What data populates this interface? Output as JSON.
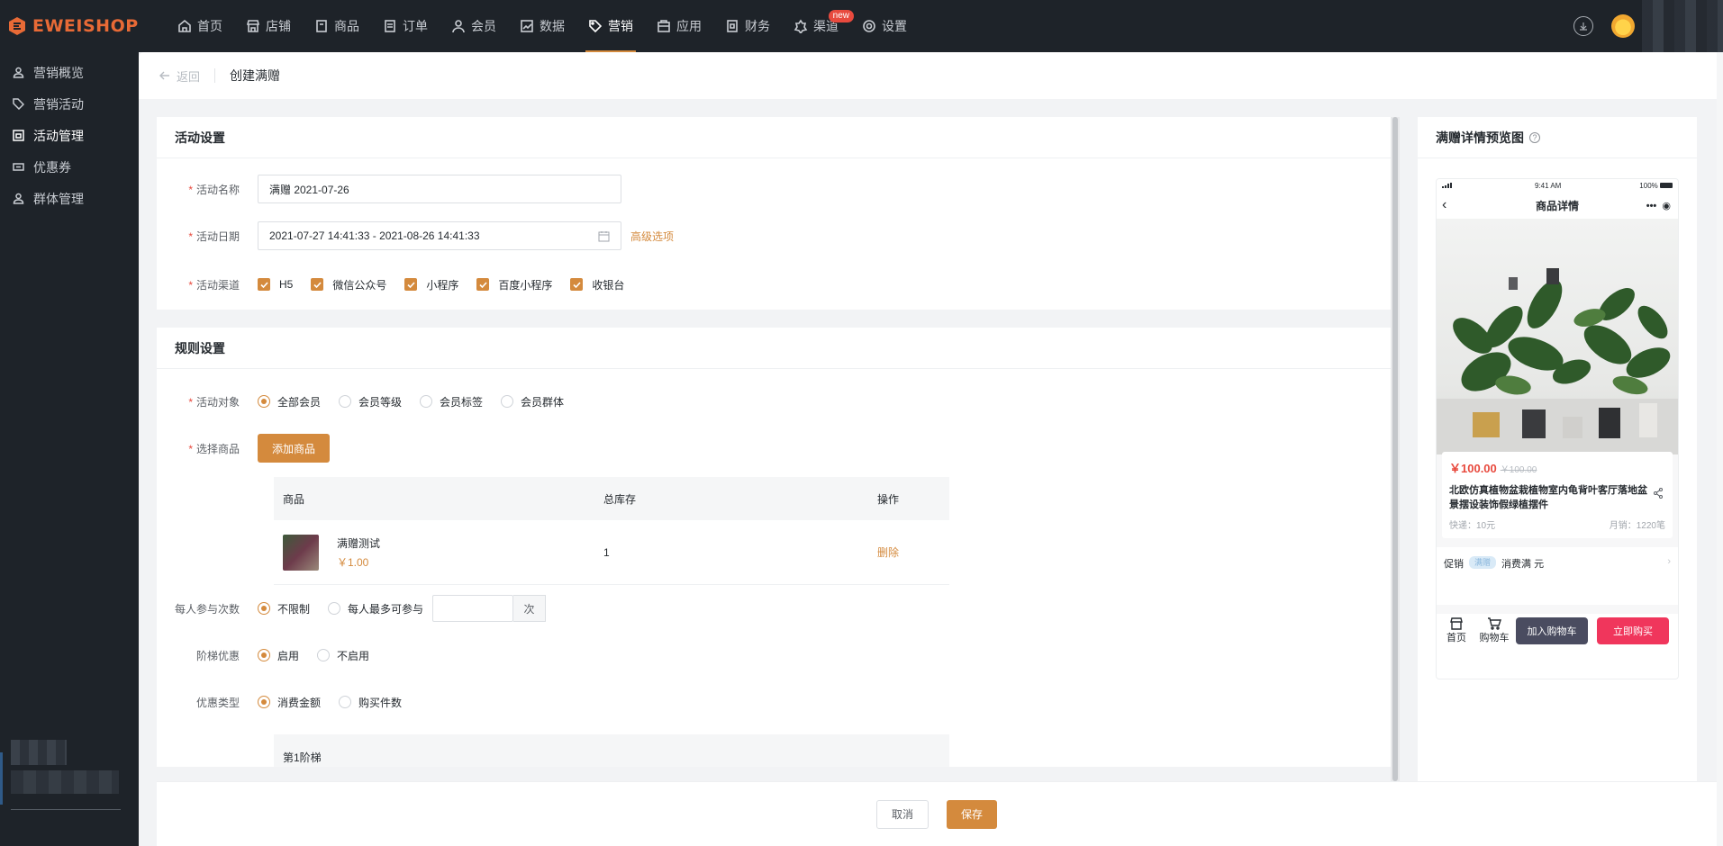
{
  "app": {
    "logo_text": "EWEISHOP"
  },
  "nav": {
    "items": [
      {
        "label": "首页",
        "icon": "home-icon"
      },
      {
        "label": "店铺",
        "icon": "store-icon"
      },
      {
        "label": "商品",
        "icon": "goods-icon"
      },
      {
        "label": "订单",
        "icon": "order-icon"
      },
      {
        "label": "会员",
        "icon": "user-icon"
      },
      {
        "label": "数据",
        "icon": "chart-icon"
      },
      {
        "label": "营销",
        "icon": "tag-icon",
        "active": true
      },
      {
        "label": "应用",
        "icon": "app-icon"
      },
      {
        "label": "财务",
        "icon": "finance-icon"
      },
      {
        "label": "渠道",
        "icon": "channel-icon",
        "badge": "new"
      },
      {
        "label": "设置",
        "icon": "gear-icon"
      }
    ]
  },
  "sidebar": {
    "items": [
      {
        "label": "营销概览"
      },
      {
        "label": "营销活动"
      },
      {
        "label": "活动管理",
        "active": true
      },
      {
        "label": "优惠券"
      },
      {
        "label": "群体管理"
      }
    ]
  },
  "breadcrumb": {
    "back": "返回",
    "title": "创建满赠"
  },
  "activity_settings": {
    "title": "活动设置",
    "name_label": "活动名称",
    "name_value": "满赠  2021-07-26",
    "date_label": "活动日期",
    "date_value": "2021-07-27 14:41:33  -  2021-08-26 14:41:33",
    "advanced_link": "高级选项",
    "channel_label": "活动渠道",
    "channels": [
      "H5",
      "微信公众号",
      "小程序",
      "百度小程序",
      "收银台"
    ]
  },
  "rule_settings": {
    "title": "规则设置",
    "target_label": "活动对象",
    "targets": [
      "全部会员",
      "会员等级",
      "会员标签",
      "会员群体"
    ],
    "goods_label": "选择商品",
    "add_goods_button": "添加商品",
    "table": {
      "headers": [
        "商品",
        "总库存",
        "操作"
      ],
      "rows": [
        {
          "name": "满赠测试",
          "price": "￥1.00",
          "stock": "1",
          "action": "删除"
        }
      ]
    },
    "times_label": "每人参与次数",
    "times_options": [
      "不限制",
      "每人最多可参与"
    ],
    "times_unit": "次",
    "ladder_label": "阶梯优惠",
    "ladder_options": [
      "启用",
      "不启用"
    ],
    "discount_label": "优惠类型",
    "discount_options": [
      "消费金额",
      "购买件数"
    ],
    "tier_header": "第1阶梯"
  },
  "footer": {
    "cancel": "取消",
    "save": "保存"
  },
  "preview": {
    "title": "满赠详情预览图",
    "help": "?",
    "status_time": "9:41 AM",
    "status_battery": "100%",
    "nav_title": "商品详情",
    "price_now": "￥100.00",
    "price_old": "￥100.00",
    "product_title": "北欧仿真植物盆栽植物室内龟背叶客厅落地盆景摆设装饰假绿植摆件",
    "shipping": "快递：10元",
    "monthly_sales": "月销：1220笔",
    "promo_label": "促销",
    "promo_tag": "满赠",
    "promo_text": "消费满 元",
    "home": "首页",
    "cart": "购物车",
    "add_cart": "加入购物车",
    "buy_now": "立即购买"
  }
}
